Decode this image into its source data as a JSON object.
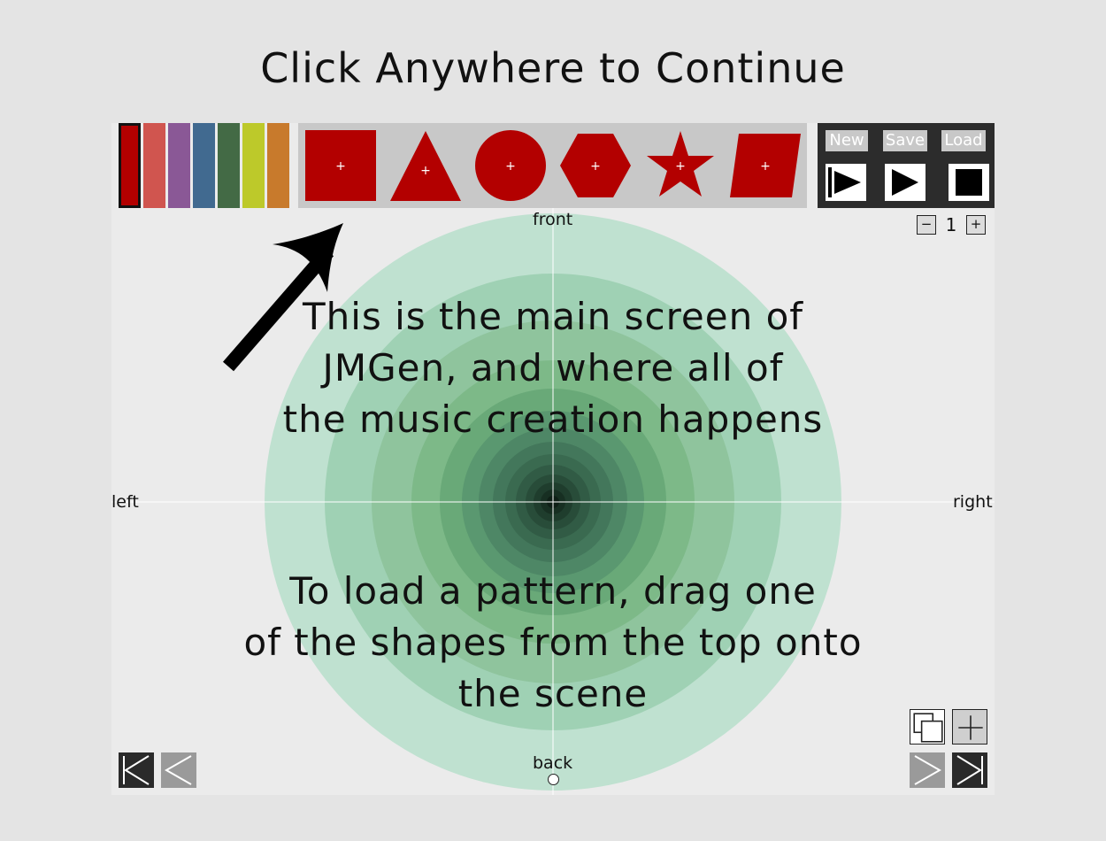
{
  "banner": {
    "text": "Click Anywhere to Continue"
  },
  "palette": {
    "colors": [
      "#b30000",
      "#d0554f",
      "#8a5896",
      "#416a90",
      "#436a45",
      "#bdc92a",
      "#c87a2c"
    ],
    "selected_index": 0
  },
  "shapes": {
    "color": "#b30000",
    "items": [
      "square",
      "triangle",
      "circle",
      "hexagon",
      "star",
      "parallelogram"
    ]
  },
  "controls": {
    "new_label": "New",
    "save_label": "Save",
    "load_label": "Load",
    "buttons": [
      "play-from-start-icon",
      "play-icon",
      "stop-icon"
    ]
  },
  "zoom": {
    "minus": "−",
    "value": "1",
    "plus": "+"
  },
  "scene": {
    "front": "front",
    "back": "back",
    "left": "left",
    "right": "right",
    "ring_colors": [
      "#bfe1d0",
      "#9fd1b4",
      "#8fc49d",
      "#7db988",
      "#69a978",
      "#5a9870",
      "#4e8766",
      "#43775b",
      "#3a6a50",
      "#315b45",
      "#284c39",
      "#1f3d2d",
      "#172f22",
      "#0e1f16"
    ]
  },
  "tutorial": {
    "main_text": "This is the main screen of\nJMGen, and where all of\nthe music creation happens",
    "load_text": "To load a pattern, drag one\nof the shapes from the top onto\nthe scene"
  },
  "bottom_controls": {
    "left": [
      "first-page-icon",
      "previous-page-icon"
    ],
    "right_top": [
      "duplicate-icon",
      "add-icon"
    ],
    "right_bottom": [
      "next-page-icon",
      "last-page-icon"
    ]
  }
}
